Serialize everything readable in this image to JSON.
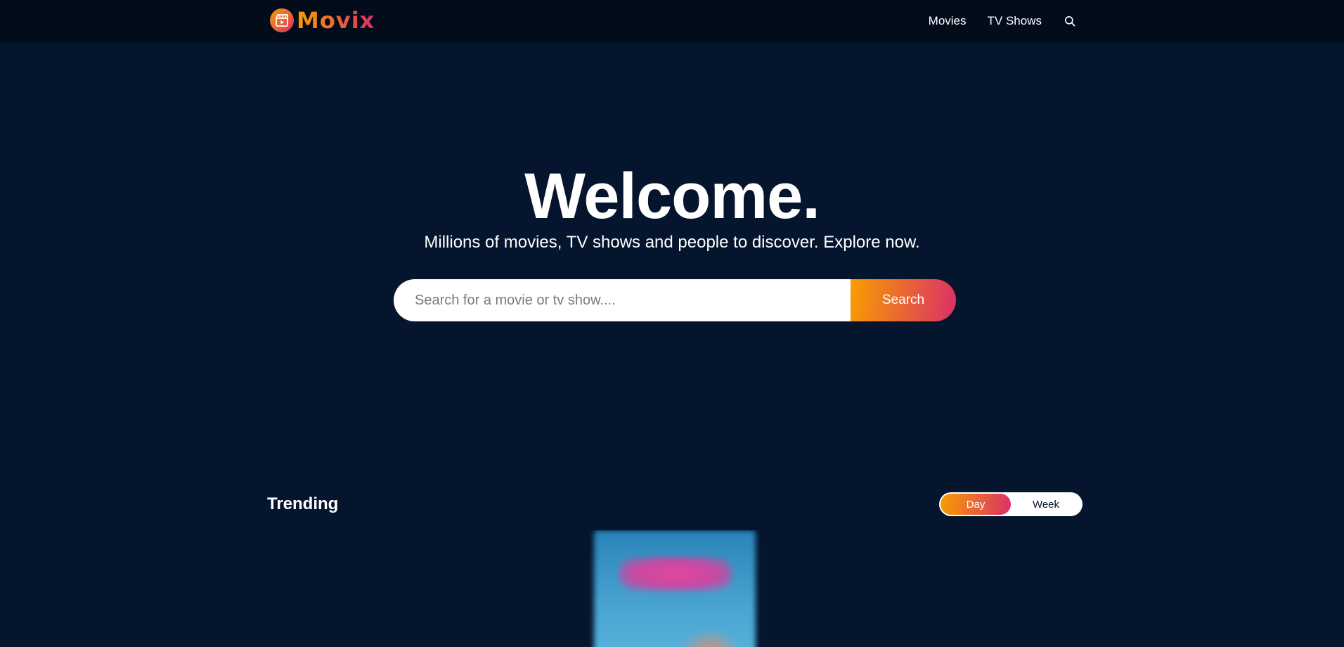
{
  "header": {
    "logo_text": "Movix",
    "nav": {
      "movies_label": "Movies",
      "tv_shows_label": "TV Shows"
    }
  },
  "hero": {
    "title": "Welcome.",
    "subtitle": "Millions of movies, TV shows and people to discover. Explore now.",
    "search_placeholder": "Search for a movie or tv show....",
    "search_button_label": "Search"
  },
  "trending": {
    "title": "Trending",
    "tabs": [
      {
        "label": "Day",
        "active": true
      },
      {
        "label": "Week",
        "active": false
      }
    ]
  },
  "colors": {
    "background": "#04152d",
    "header_background": "#020c1b",
    "accent_gradient_start": "#f89e00",
    "accent_gradient_end": "#da2f68"
  },
  "icons": {
    "logo": "clapperboard-icon",
    "search": "search-icon"
  }
}
